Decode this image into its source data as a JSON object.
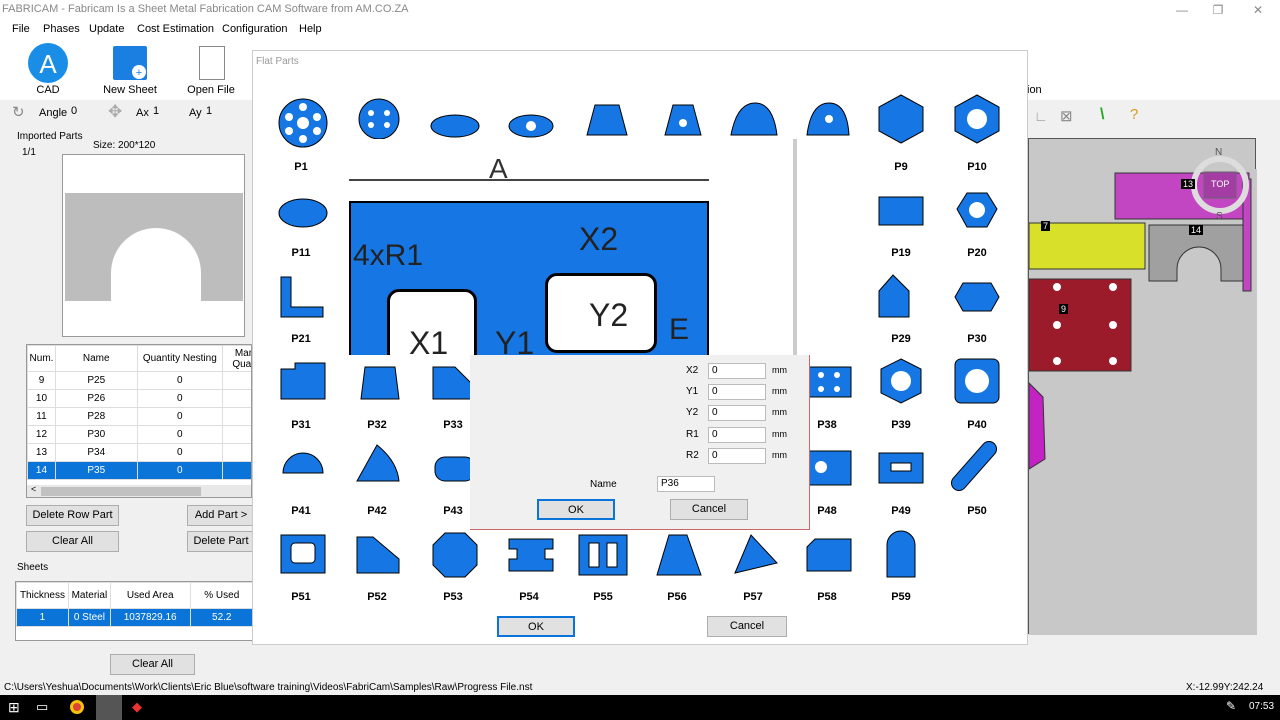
{
  "window": {
    "title": "FABRICAM - Fabricam Is a Sheet Metal Fabrication CAM Software from AM.CO.ZA",
    "min": "—",
    "max": "❐",
    "close": "✕"
  },
  "menu": [
    "File",
    "Phases",
    "Update",
    "Cost Estimation",
    "Configuration",
    "Help"
  ],
  "ribbon": {
    "cad": "CAD",
    "new_sheet": "New Sheet",
    "open_file": "Open File",
    "option_fragment": "ion"
  },
  "controls": {
    "angle_label": "Angle",
    "angle_value": "0",
    "ax_label": "Ax",
    "ax_value": "1",
    "ay_label": "Ay",
    "ay_value": "1"
  },
  "imported": {
    "title": "Imported Parts",
    "page": "1/1",
    "size": "Size: 200*120"
  },
  "parts_table": {
    "headers": [
      "Num.",
      "Name",
      "Quantity Nesting",
      "Man Quan"
    ],
    "rows": [
      {
        "num": "9",
        "name": "P25",
        "qty": "0"
      },
      {
        "num": "10",
        "name": "P26",
        "qty": "0"
      },
      {
        "num": "11",
        "name": "P28",
        "qty": "0"
      },
      {
        "num": "12",
        "name": "P30",
        "qty": "0"
      },
      {
        "num": "13",
        "name": "P34",
        "qty": "0"
      },
      {
        "num": "14",
        "name": "P35",
        "qty": "0"
      }
    ],
    "selected_index": 5
  },
  "buttons": {
    "delete_row": "Delete Row Part",
    "add_part": "Add Part >",
    "clear_all": "Clear All",
    "delete_part": "Delete Part",
    "clear_all2": "Clear All"
  },
  "sheets": {
    "title": "Sheets",
    "headers": [
      "Thickness",
      "Material",
      "Used Area",
      "% Used"
    ],
    "row": {
      "thickness": "1",
      "material": "0  Steel",
      "area": "1037829.16",
      "used": "52.2"
    }
  },
  "status": {
    "path": "C:\\Users\\Yeshua\\Documents\\Work\\Clients\\Eric Blue\\software training\\Videos\\FabriCam\\Samples\\Raw\\Progress File.nst",
    "coords": "X:-12.99Y:242.24"
  },
  "taskbar": {
    "time": "07:53"
  },
  "canvas": {
    "north": "N",
    "south": "S",
    "top": "TOP",
    "labels": [
      "13",
      "7",
      "14",
      "9"
    ]
  },
  "dialog": {
    "title": "Flat Parts",
    "parts": [
      "P1",
      "P9",
      "P10",
      "P11",
      "P19",
      "P20",
      "P21",
      "P29",
      "P30",
      "P31",
      "P32",
      "P33",
      "P38",
      "P39",
      "P40",
      "P41",
      "P42",
      "P43",
      "P48",
      "P49",
      "P50",
      "P51",
      "P52",
      "P53",
      "P54",
      "P55",
      "P56",
      "P57",
      "P58",
      "P59"
    ],
    "ok": "OK",
    "cancel": "Cancel",
    "preview": {
      "A": "A",
      "R": "4xR1",
      "X1": "X1",
      "X2": "X2",
      "Y1": "Y1",
      "Y2": "Y2",
      "E": "E"
    }
  },
  "subdialog": {
    "fields": [
      {
        "label": "X2",
        "value": "0",
        "unit": "mm"
      },
      {
        "label": "Y1",
        "value": "0",
        "unit": "mm"
      },
      {
        "label": "Y2",
        "value": "0",
        "unit": "mm"
      },
      {
        "label": "R1",
        "value": "0",
        "unit": "mm"
      },
      {
        "label": "R2",
        "value": "0",
        "unit": "mm"
      }
    ],
    "name_label": "Name",
    "name_value": "P36",
    "ok": "OK",
    "cancel": "Cancel"
  },
  "colors": {
    "blue": "#1677e4",
    "selection": "#0a74d9",
    "magenta": "#c246c2",
    "yellow": "#d8e02a",
    "maroon": "#9b1b2a",
    "gray": "#a0a0a0"
  }
}
